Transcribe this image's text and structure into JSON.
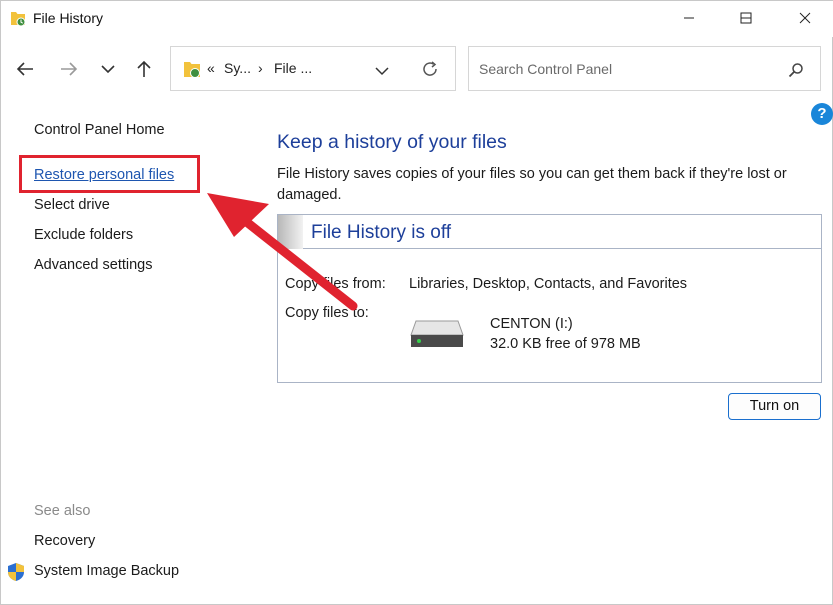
{
  "window": {
    "title": "File History"
  },
  "titlebar": {
    "minimize_icon": "minimize-icon",
    "maximize_icon": "maximize-icon",
    "close_icon": "close-icon"
  },
  "address_bar": {
    "prefix": "«",
    "crumb_1": "Sy...",
    "separator": "›",
    "crumb_2": "File ...",
    "dropdown_icon": "chevron-down-icon",
    "refresh_icon": "refresh-icon"
  },
  "search": {
    "placeholder": "Search Control Panel"
  },
  "help": {
    "label": "?"
  },
  "left_nav": {
    "home": "Control Panel Home",
    "restore": "Restore personal files",
    "select_drive": "Select drive",
    "exclude_folders": "Exclude folders",
    "advanced_settings": "Advanced settings",
    "see_also": "See also",
    "recovery": "Recovery",
    "system_image_backup": "System Image Backup"
  },
  "main": {
    "heading": "Keep a history of your files",
    "description": "File History saves copies of your files so you can get them back if they're lost or damaged.",
    "panel": {
      "title": "File History is off",
      "copy_from_label": "Copy files from:",
      "copy_from_value": "Libraries, Desktop, Contacts, and Favorites",
      "copy_to_label": "Copy files to:",
      "drive_name": "CENTON (I:)",
      "drive_space": "32.0 KB free of 978 MB"
    },
    "turn_on_button": "Turn on"
  },
  "colors": {
    "link": "#1e56b0",
    "heading": "#1d3f9a",
    "annotation_red": "#e0232f",
    "button_border": "#1a6fce"
  }
}
